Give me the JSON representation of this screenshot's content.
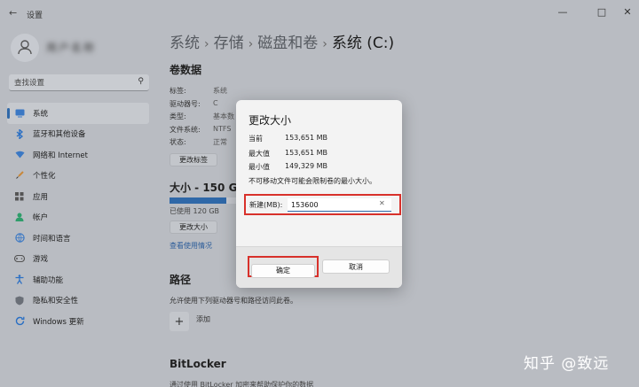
{
  "window": {
    "title": "设置"
  },
  "user": {
    "name": "用户名称"
  },
  "search": {
    "placeholder": "查找设置"
  },
  "sidebar": {
    "items": [
      {
        "label": "系统",
        "icon": "monitor-icon",
        "active": true
      },
      {
        "label": "蓝牙和其他设备",
        "icon": "bluetooth-icon"
      },
      {
        "label": "网络和 Internet",
        "icon": "wifi-icon"
      },
      {
        "label": "个性化",
        "icon": "brush-icon"
      },
      {
        "label": "应用",
        "icon": "apps-icon"
      },
      {
        "label": "帐户",
        "icon": "person-icon"
      },
      {
        "label": "时间和语言",
        "icon": "globe-clock-icon"
      },
      {
        "label": "游戏",
        "icon": "game-controller-icon"
      },
      {
        "label": "辅助功能",
        "icon": "accessibility-icon"
      },
      {
        "label": "隐私和安全性",
        "icon": "shield-icon"
      },
      {
        "label": "Windows 更新",
        "icon": "update-icon"
      }
    ]
  },
  "breadcrumb": [
    "系统",
    "存储",
    "磁盘和卷",
    "系统 (C:)"
  ],
  "volume": {
    "heading": "卷数据",
    "props": [
      {
        "key": "标签:",
        "value": "系统"
      },
      {
        "key": "驱动器号:",
        "value": "C"
      },
      {
        "key": "类型:",
        "value": "基本数"
      },
      {
        "key": "文件系统:",
        "value": "NTFS"
      },
      {
        "key": "状态:",
        "value": "正常"
      }
    ],
    "change_label_button": "更改标签"
  },
  "size": {
    "heading": "大小 - 150 GB",
    "used_text": "已使用 120 GB",
    "used_fraction": 0.8,
    "resize_button": "更改大小",
    "usage_link": "查看使用情况"
  },
  "paths": {
    "heading": "路径",
    "desc": "允许使用下列驱动器号和路径访问此卷。",
    "add_label": "添加"
  },
  "bitlocker": {
    "heading": "BitLocker",
    "desc": "通过使用 BitLocker 加密来帮助保护你的数据"
  },
  "dialog": {
    "title": "更改大小",
    "rows": [
      {
        "label": "当前",
        "value": "153,651 MB"
      },
      {
        "label": "最大值",
        "value": "153,651 MB"
      },
      {
        "label": "最小值",
        "value": "149,329 MB"
      }
    ],
    "note": "不可移动文件可能会限制卷的最小大小。",
    "new_label": "新建(MB):",
    "new_value": "153600",
    "ok": "确定",
    "cancel": "取消"
  },
  "watermark": "知乎 @致远",
  "colors": {
    "accent": "#2f68a8",
    "highlight": "#d8312b"
  }
}
